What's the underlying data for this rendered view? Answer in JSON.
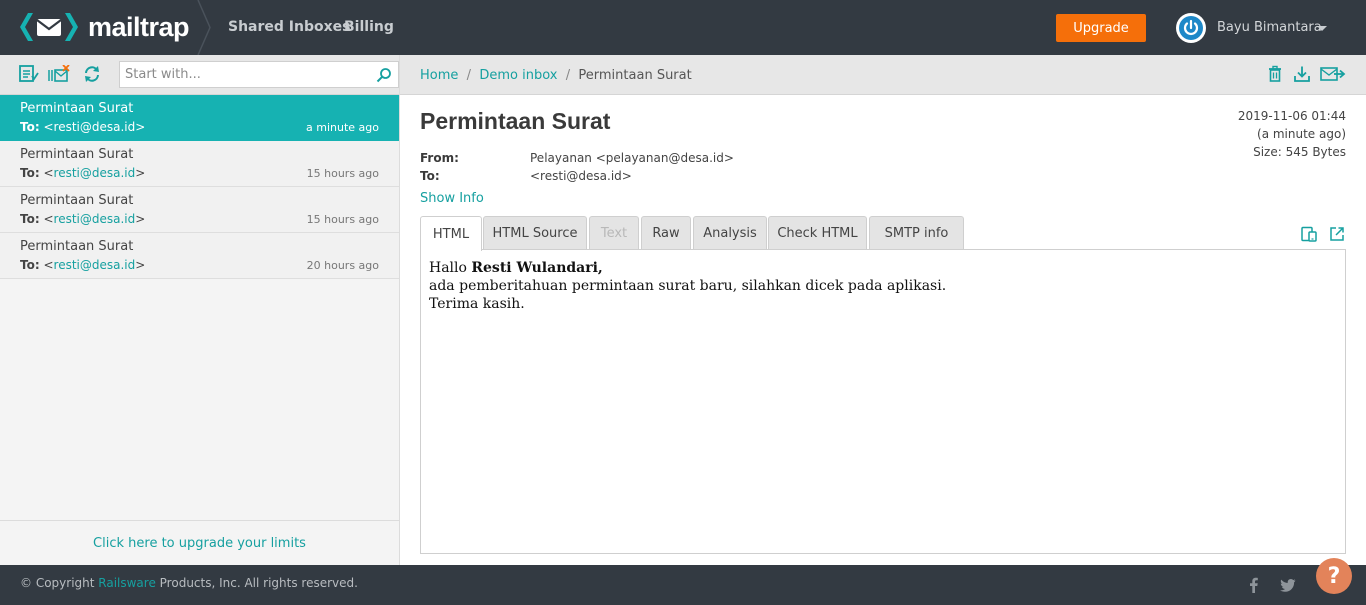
{
  "topbar": {
    "brand": "mailtrap",
    "nav": [
      "Shared Inboxes",
      "Billing"
    ],
    "upgrade_label": "Upgrade",
    "user_name": "Bayu Bimantara"
  },
  "sidebar": {
    "search_placeholder": "Start with...",
    "messages": [
      {
        "subject": "Permintaan Surat",
        "to_label": "To:",
        "to_addr_open": "<",
        "to_addr": "resti@desa.id",
        "to_addr_close": ">",
        "time": "a minute ago",
        "active": true
      },
      {
        "subject": "Permintaan Surat",
        "to_label": "To:",
        "to_addr_open": "<",
        "to_addr": "resti@desa.id",
        "to_addr_close": ">",
        "time": "15 hours ago",
        "active": false
      },
      {
        "subject": "Permintaan Surat",
        "to_label": "To:",
        "to_addr_open": "<",
        "to_addr": "resti@desa.id",
        "to_addr_close": ">",
        "time": "15 hours ago",
        "active": false
      },
      {
        "subject": "Permintaan Surat",
        "to_label": "To:",
        "to_addr_open": "<",
        "to_addr": "resti@desa.id",
        "to_addr_close": ">",
        "time": "20 hours ago",
        "active": false
      }
    ],
    "upgrade_limits": "Click here to upgrade your limits"
  },
  "breadcrumb": {
    "home": "Home",
    "inbox": "Demo inbox",
    "current": "Permintaan Surat",
    "sep": "/"
  },
  "message": {
    "subject": "Permintaan Surat",
    "date": "2019-11-06 01:44",
    "relative": "(a minute ago)",
    "size": "Size: 545 Bytes",
    "from_label": "From:",
    "from_value": "Pelayanan <pelayanan@desa.id>",
    "to_label": "To:",
    "to_value": "<resti@desa.id>",
    "show_info": "Show Info",
    "tabs": [
      "HTML",
      "HTML Source",
      "Text",
      "Raw",
      "Analysis",
      "Check HTML",
      "SMTP info"
    ],
    "active_tab": "HTML",
    "disabled_tab": "Text",
    "body": {
      "greeting": "Hallo ",
      "name": "Resti Wulandari,",
      "line2": "ada pemberitahuan permintaan surat baru, silahkan dicek pada aplikasi.",
      "line3": "Terima kasih."
    }
  },
  "footer": {
    "copy_prefix": "© Copyright ",
    "company": "Railsware",
    "copy_suffix": " Products, Inc. All rights reserved.",
    "help_label": "?"
  },
  "colors": {
    "teal": "#16b2b2",
    "orange": "#f56f0a",
    "dark": "#333a42"
  }
}
